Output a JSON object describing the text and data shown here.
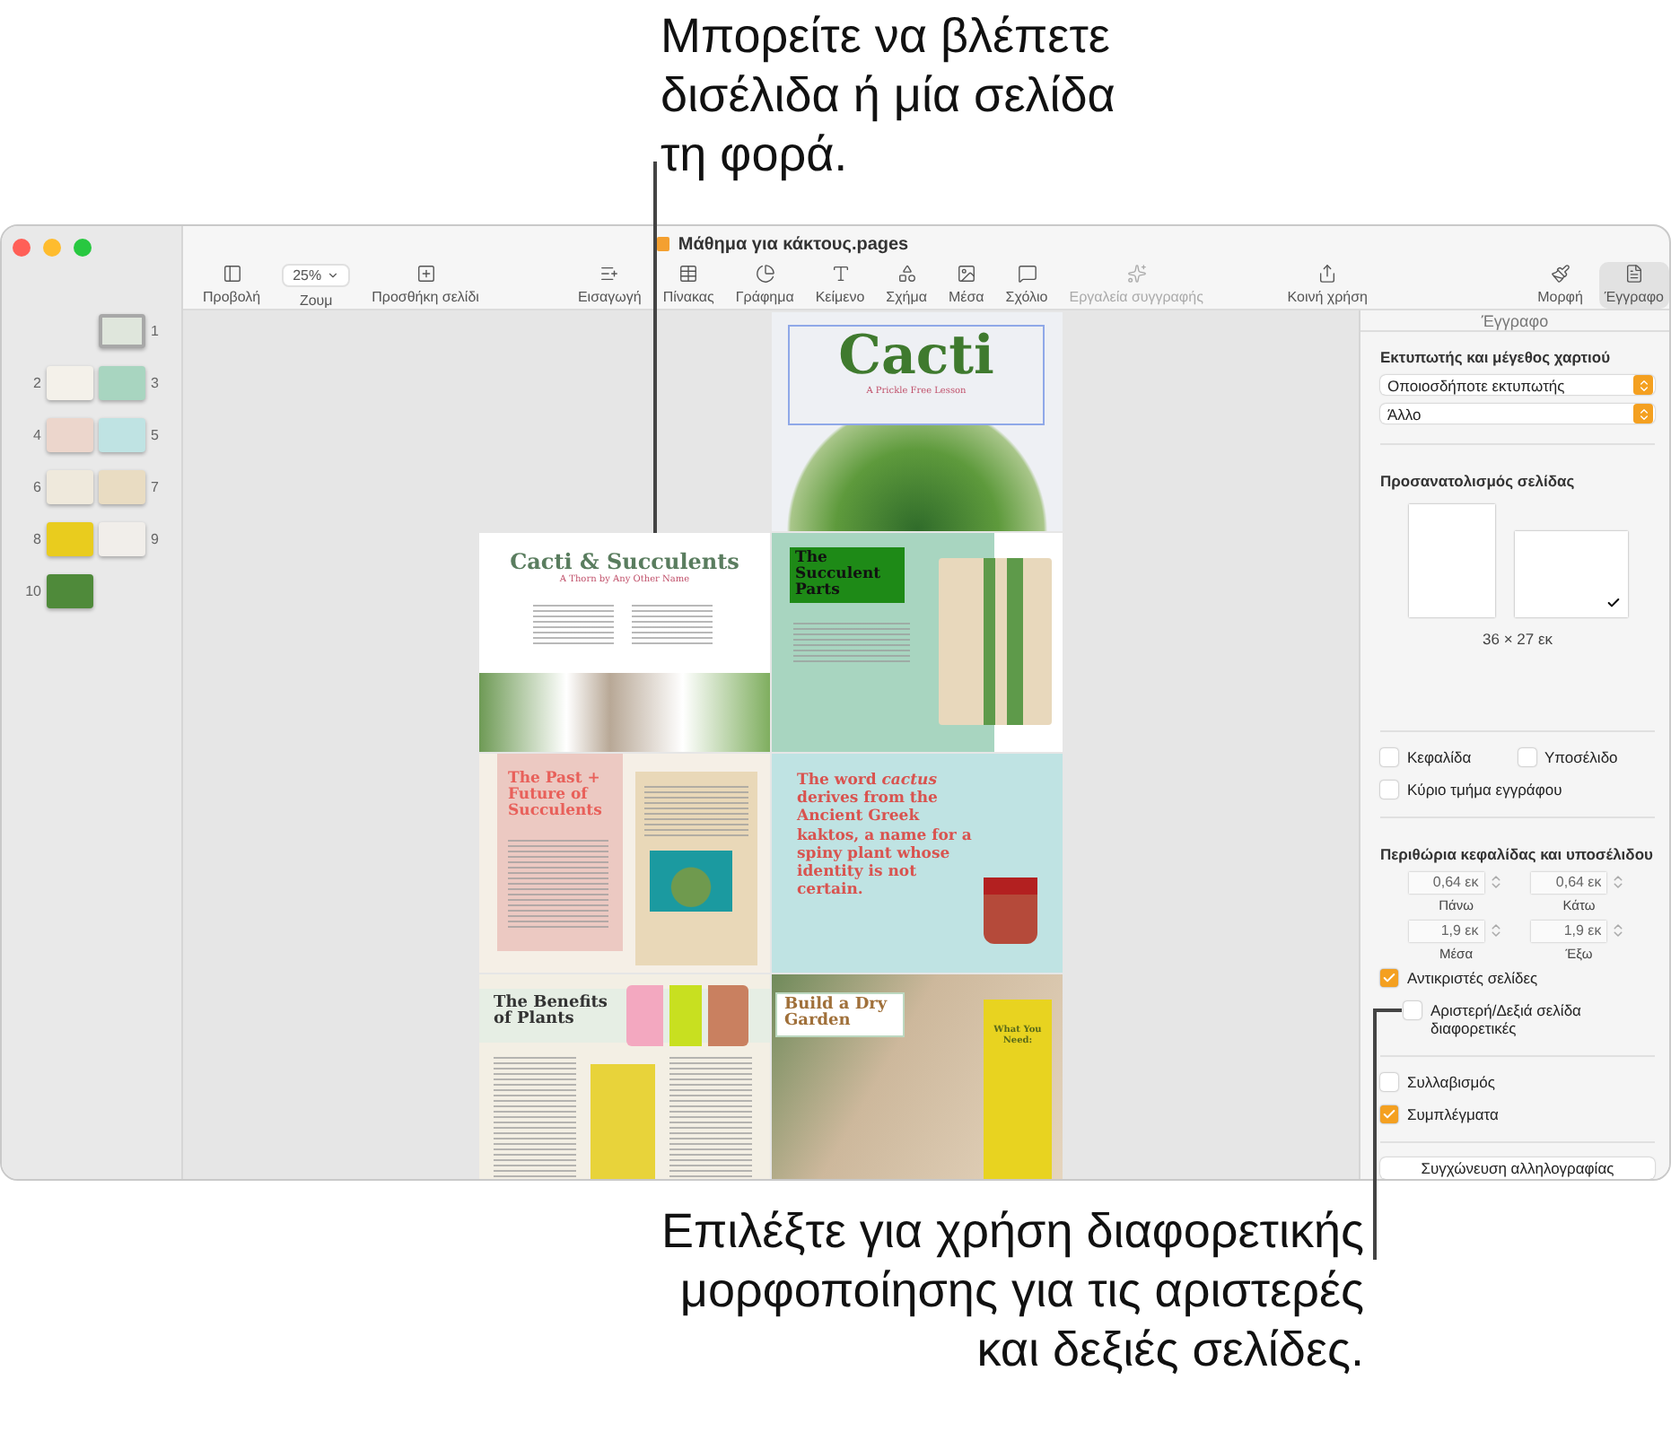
{
  "callouts": [
    {
      "text": "Μπορείτε να βλέπετε\nδισέλιδα ή μία σελίδα\nτη φορά."
    },
    {
      "text": "Επιλέξτε για χρήση διαφορετικής\nμορφοποίησης για τις αριστερές\nκαι δεξιές σελίδες."
    }
  ],
  "window": {
    "title": "Μάθημα για κάκτους.pages"
  },
  "toolbar": {
    "groups": [
      [
        {
          "kind": "button",
          "label": "Προβολή"
        },
        {
          "kind": "dropdown",
          "value": "25%",
          "label": "Ζουμ"
        },
        {
          "kind": "button",
          "label": "Προσθήκη σελίδι"
        }
      ],
      [
        {
          "kind": "button",
          "label": "Εισαγωγή",
          "disabled": false
        },
        {
          "kind": "button",
          "label": "Πίνακας",
          "disabled": false
        },
        {
          "kind": "button",
          "label": "Γράφημα",
          "disabled": false
        },
        {
          "kind": "button",
          "label": "Κείμενο",
          "disabled": false
        },
        {
          "kind": "button",
          "label": "Σχήμα",
          "disabled": false
        },
        {
          "kind": "button",
          "label": "Μέσα",
          "disabled": false
        },
        {
          "kind": "button",
          "label": "Σχόλιο",
          "disabled": false
        },
        {
          "kind": "button",
          "label": "Εργαλεία συγγραφής",
          "disabled": true
        }
      ],
      [
        {
          "kind": "button",
          "label": "Κοινή χρήση"
        }
      ],
      [
        {
          "kind": "button",
          "label": "Μορφή",
          "selected": false
        },
        {
          "kind": "button",
          "label": "Έγγραφο",
          "selected": true
        }
      ]
    ]
  },
  "thumbnails": [
    {
      "number": "1",
      "selected": true,
      "color": "#dfe6dc"
    },
    {
      "number": "2",
      "selected": false,
      "color": "#f4f1ea"
    },
    {
      "number": "3",
      "selected": false,
      "color": "#a8d5c0"
    },
    {
      "number": "4",
      "selected": false,
      "color": "#ecd6cc"
    },
    {
      "number": "5",
      "selected": false,
      "color": "#bfe3e3"
    },
    {
      "number": "6",
      "selected": false,
      "color": "#efe9dc"
    },
    {
      "number": "7",
      "selected": false,
      "color": "#e9dcc2"
    },
    {
      "number": "8",
      "selected": false,
      "color": "#e9cc1e"
    },
    {
      "number": "9",
      "selected": false,
      "color": "#f1eeea"
    },
    {
      "number": "10",
      "selected": false,
      "color": "#4f8a3a"
    }
  ],
  "pages": [
    {
      "kind": "cover",
      "title": "Cacti",
      "subtitle": "A Prickle Free Lesson"
    },
    {
      "kind": "title-photo",
      "title": "Cacti & Succulents",
      "subtitle": "A Thorn by Any Other Name"
    },
    {
      "kind": "parts",
      "title": "The Succulent Parts"
    },
    {
      "kind": "history",
      "title": "The Past + Future of Succulents"
    },
    {
      "kind": "quote",
      "title": "The word *cactus* derives from the Ancient Greek kaktos, a name for a spiny plant whose identity is not certain."
    },
    {
      "kind": "benefits",
      "title": "The Benefits of Plants"
    },
    {
      "kind": "garden",
      "title": "Build a Dry Garden",
      "subtitle": "What You Need:"
    }
  ],
  "inspector": {
    "title": "Έγγραφο",
    "printer": {
      "heading": "Εκτυπωτής και μέγεθος χαρτιού",
      "selects": [
        "Οποιοσδήποτε εκτυπωτής",
        "Άλλο"
      ]
    },
    "orientation": {
      "heading": "Προσανατολισμός σελίδας",
      "options": [
        {
          "kind": "portrait",
          "selected": false
        },
        {
          "kind": "landscape",
          "selected": true
        }
      ],
      "size": "36 × 27 εκ"
    },
    "header_footer": [
      {
        "label": "Κεφαλίδα",
        "checked": false
      },
      {
        "label": "Υποσέλιδο",
        "checked": false
      },
      {
        "label": "Κύριο τμήμα εγγράφου",
        "checked": false
      }
    ],
    "margins": {
      "heading": "Περιθώρια κεφαλίδας και υποσέλιδου",
      "fields": [
        {
          "value": "0,64 εκ",
          "label": "Πάνω"
        },
        {
          "value": "0,64 εκ",
          "label": "Κάτω"
        },
        {
          "value": "1,9 εκ",
          "label": "Μέσα"
        },
        {
          "value": "1,9 εκ",
          "label": "Έξω"
        }
      ]
    },
    "facing": [
      {
        "label": "Αντικριστές σελίδες",
        "checked": true,
        "children": [
          {
            "label": "Αριστερή/Δεξιά σελίδα διαφορετικές",
            "checked": false
          }
        ]
      }
    ],
    "text_options": [
      {
        "label": "Συλλαβισμός",
        "checked": false
      },
      {
        "label": "Συμπλέγματα",
        "checked": true
      }
    ],
    "button": "Συγχώνευση αλληλογραφίας"
  }
}
